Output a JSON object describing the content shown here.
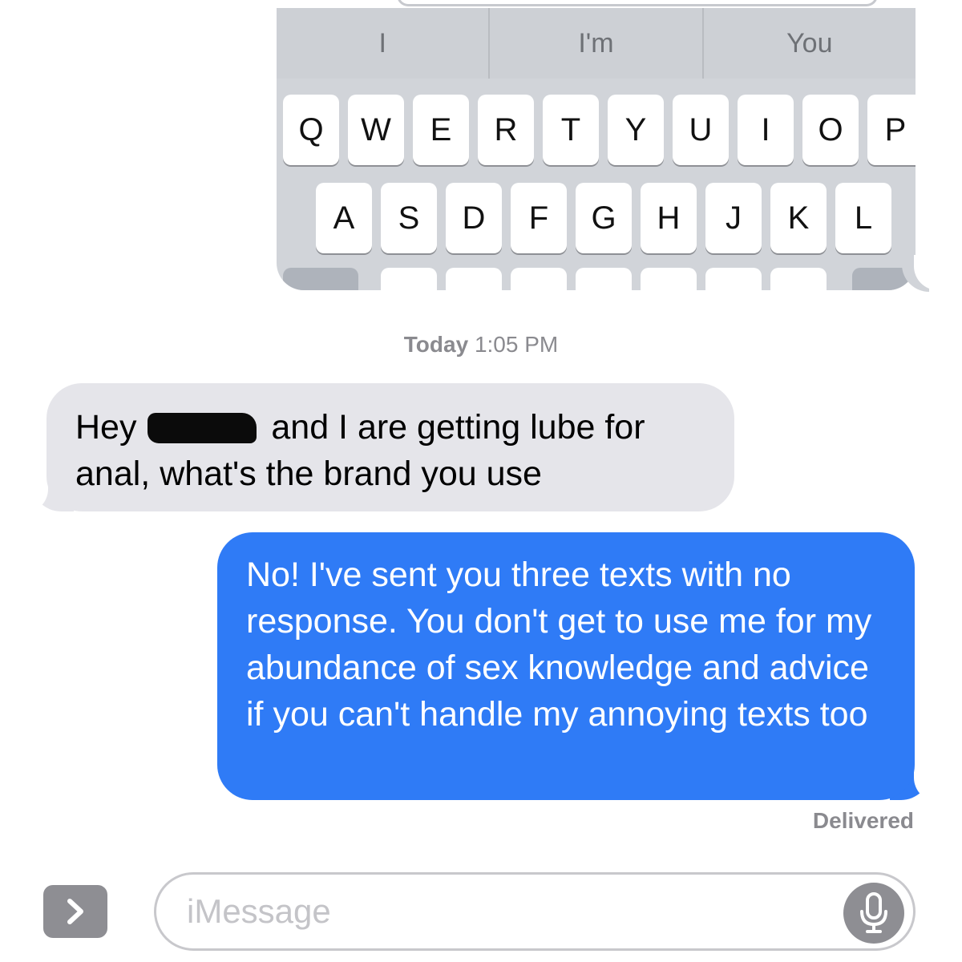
{
  "keyboard_screenshot": {
    "suggestions": [
      "I",
      "I'm",
      "You"
    ],
    "row1": [
      "Q",
      "W",
      "E",
      "R",
      "T",
      "Y",
      "U",
      "I",
      "O",
      "P"
    ],
    "row2": [
      "A",
      "S",
      "D",
      "F",
      "G",
      "H",
      "J",
      "K",
      "L"
    ]
  },
  "timestamp": {
    "day": "Today",
    "time": "1:05 PM"
  },
  "messages": {
    "incoming": {
      "part1": "Hey",
      "part2": "and I are getting lube for anal, what's the brand you use"
    },
    "outgoing": {
      "text": "No! I've sent you three texts with no response. You don't get to use me for my abundance of sex knowledge and advice if you can't handle my annoying texts too"
    }
  },
  "status": {
    "delivered": "Delivered"
  },
  "input_bar": {
    "placeholder": "iMessage"
  },
  "icons": {
    "expand": "chevron-right-icon",
    "mic": "microphone-icon"
  },
  "colors": {
    "outgoing_bubble": "#2f7bf6",
    "incoming_bubble": "#e5e5ea",
    "meta_text": "#8a8a8f"
  }
}
